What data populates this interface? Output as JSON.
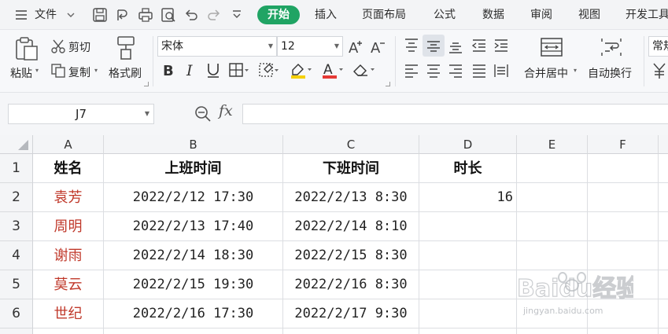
{
  "menubar": {
    "file_label": "文件",
    "tabs": [
      "开始",
      "插入",
      "页面布局",
      "公式",
      "数据",
      "审阅",
      "视图",
      "开发工具"
    ]
  },
  "ribbon": {
    "paste": "粘贴",
    "cut": "剪切",
    "copy": "复制",
    "format_painter": "格式刷",
    "font_name": "宋体",
    "font_size": "12",
    "merge_center": "合并居中",
    "wrap_text": "自动换行",
    "number_format": "常规"
  },
  "formula_bar": {
    "cell_ref": "J7",
    "fx": "fx",
    "value": ""
  },
  "grid": {
    "columns": [
      "A",
      "B",
      "C",
      "D",
      "E",
      "F"
    ],
    "rows": [
      "1",
      "2",
      "3",
      "4",
      "5",
      "6"
    ],
    "header": {
      "name": "姓名",
      "start": "上班时间",
      "end": "下班时间",
      "duration": "时长"
    },
    "records": [
      {
        "name": "袁芳",
        "start": "2022/2/12 17:30",
        "end": "2022/2/13 8:30",
        "duration": "16"
      },
      {
        "name": "周明",
        "start": "2022/2/13 17:40",
        "end": "2022/2/14 8:10",
        "duration": ""
      },
      {
        "name": "谢雨",
        "start": "2022/2/14 18:30",
        "end": "2022/2/15 8:30",
        "duration": ""
      },
      {
        "name": "莫云",
        "start": "2022/2/15 19:30",
        "end": "2022/2/16 8:30",
        "duration": ""
      },
      {
        "name": "世纪",
        "start": "2022/2/16 17:30",
        "end": "2022/2/17 9:30",
        "duration": ""
      }
    ]
  },
  "watermark": {
    "brand": "Baidu经验",
    "url": "jingyan.baidu.com"
  },
  "colors": {
    "accent": "#20a464",
    "name_text": "#c0392b",
    "font_color_bar": "#e53935",
    "highlight_bar": "#f5d000"
  },
  "icons": [
    "menu-icon",
    "chevron-down-icon",
    "save-icon",
    "export-icon",
    "print-icon",
    "print-preview-icon",
    "undo-icon",
    "redo-icon",
    "more-icon",
    "paste-icon",
    "scissors-icon",
    "copy-icon",
    "brush-icon",
    "zoom-icon"
  ]
}
